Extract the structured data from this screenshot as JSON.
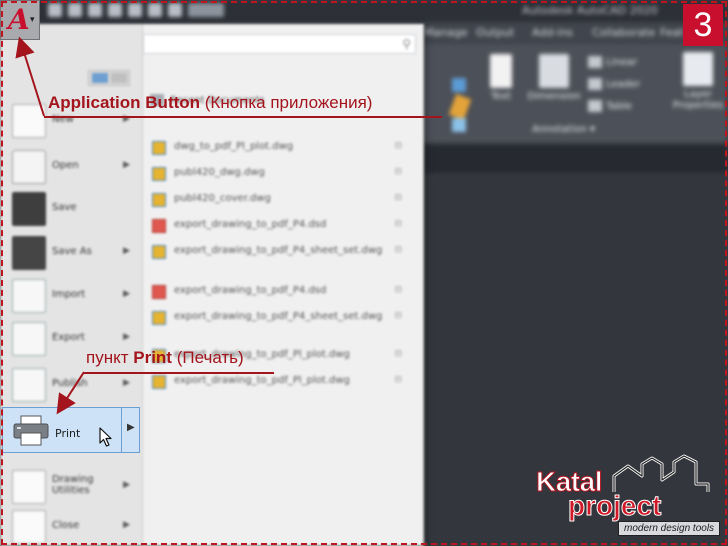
{
  "window": {
    "title": "Autodesk AutoCAD 2020"
  },
  "ribbon": {
    "tabs": [
      "Manage",
      "Output",
      "Add-ins",
      "Collaborate",
      "Feat"
    ],
    "buttons": {
      "text": "Text",
      "dimension": "Dimension",
      "layer_properties_1": "Layer",
      "layer_properties_2": "Properties"
    },
    "small_buttons": [
      "Linear",
      "Leader",
      "Table"
    ],
    "panel_annotation": "Annotation ▾"
  },
  "app_menu": {
    "search_placeholder": "",
    "recent_documents_header": "Recent Documents",
    "left_items": [
      {
        "label": "New",
        "icon": "new-document-icon"
      },
      {
        "label": "Open",
        "icon": "open-folder-icon"
      },
      {
        "label": "Save",
        "icon": "save-disk-icon"
      },
      {
        "label": "Save As",
        "icon": "save-as-icon"
      },
      {
        "label": "Import",
        "icon": "import-icon"
      },
      {
        "label": "Export",
        "icon": "export-icon"
      },
      {
        "label": "Publish",
        "icon": "publish-icon"
      },
      {
        "label": "Print",
        "icon": "printer-icon"
      },
      {
        "label": "Drawing Utilities",
        "icon": "drawing-utilities-icon"
      },
      {
        "label": "Close",
        "icon": "close-icon"
      }
    ],
    "recent_documents": [
      {
        "name": "dwg_to_pdf_Pl_plot.dwg",
        "type": "dwg"
      },
      {
        "name": "publ420_dwg.dwg",
        "type": "dwg"
      },
      {
        "name": "publ420_cover.dwg",
        "type": "dwg"
      },
      {
        "name": "export_drawing_to_pdf_P4.dsd",
        "type": "pdf"
      },
      {
        "name": "export_drawing_to_pdf_P4_sheet_set.dwg",
        "type": "dwg"
      },
      {
        "name": "export_drawing_to_pdf_P4.dsd",
        "type": "pdf"
      },
      {
        "name": "export_drawing_to_pdf_P4_sheet_set.dwg",
        "type": "dwg"
      },
      {
        "name": "export_drawing_to_pdf_Pl_plot.dwg",
        "type": "dwg"
      },
      {
        "name": "export_drawing_to_pdf_Pl_plot.dwg",
        "type": "dwg"
      }
    ]
  },
  "annotations": {
    "app_button_bold": "Application Button",
    "app_button_rest": " (Кнопка приложения)",
    "print_prefix": "пункт ",
    "print_bold": "Print",
    "print_suffix": " (Печать)",
    "step_number": "3"
  },
  "logo": {
    "word1": "Katal",
    "word2": "project",
    "tagline": "modern design tools"
  },
  "colors": {
    "accent_red": "#c8102e",
    "annotation_red": "#a3141c",
    "print_highlight": "#cde2f7"
  }
}
